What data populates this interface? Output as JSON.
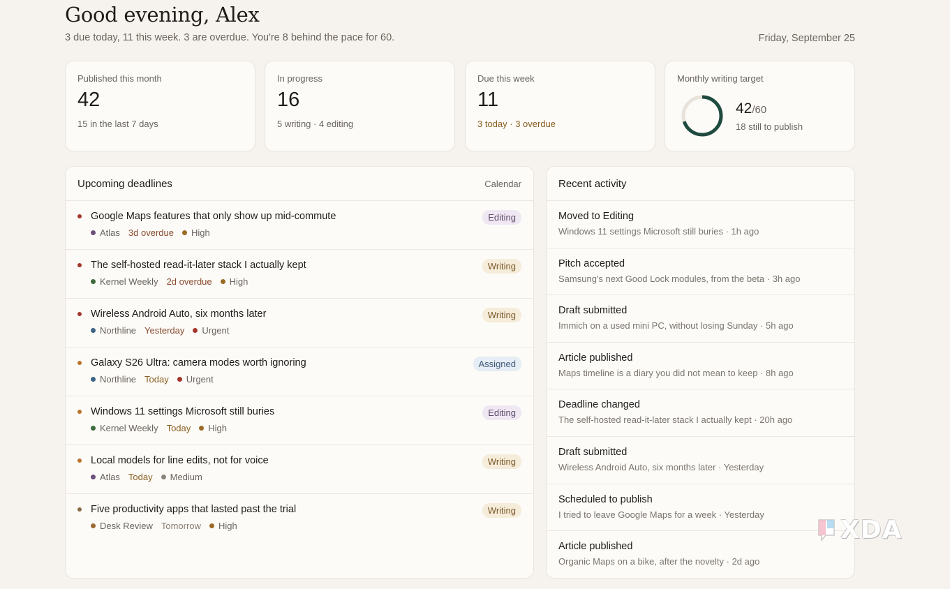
{
  "header": {
    "greeting": "Good evening, Alex",
    "summary": "3 due today, 11 this week. 3 are overdue. You're 8 behind the pace for 60.",
    "date": "Friday, September 25"
  },
  "stats": [
    {
      "label": "Published this month",
      "value": "42",
      "sub": "15 in the last 7 days"
    },
    {
      "label": "In progress",
      "value": "16",
      "sub": "5 writing · 4 editing"
    },
    {
      "label": "Due this week",
      "value": "11",
      "sub": "3 today · 3 overdue"
    }
  ],
  "target": {
    "label": "Monthly writing target",
    "value": "42",
    "of": "/60",
    "sub": "18 still to publish",
    "progress": 0.7,
    "color": "#1f4a3f",
    "track_color": "#e8e2da"
  },
  "deadlines": {
    "title": "Upcoming deadlines",
    "link": "Calendar",
    "items": [
      {
        "title": "Google Maps features that only show up mid-commute",
        "outlet": "Atlas",
        "outlet_color": "#6a4f7a",
        "due": "3d overdue",
        "due_color": "#8a4a2e",
        "priority": "High",
        "priority_color": "#9a6a24",
        "status": "Editing",
        "status_bg": "#efe8f3",
        "status_fg": "#5d4a6a",
        "bullet": "#a2362b"
      },
      {
        "title": "The self-hosted read-it-later stack I actually kept",
        "outlet": "Kernel Weekly",
        "outlet_color": "#3f6a3a",
        "due": "2d overdue",
        "due_color": "#8a4a2e",
        "priority": "High",
        "priority_color": "#9a6a24",
        "status": "Writing",
        "status_bg": "#f6ecda",
        "status_fg": "#7a5a2a",
        "bullet": "#a2362b"
      },
      {
        "title": "Wireless Android Auto, six months later",
        "outlet": "Northline",
        "outlet_color": "#3e6485",
        "due": "Yesterday",
        "due_color": "#8a4a2e",
        "priority": "Urgent",
        "priority_color": "#a2362b",
        "status": "Writing",
        "status_bg": "#f6ecda",
        "status_fg": "#7a5a2a",
        "bullet": "#a2362b"
      },
      {
        "title": "Galaxy S26 Ultra: camera modes worth ignoring",
        "outlet": "Northline",
        "outlet_color": "#3e6485",
        "due": "Today",
        "due_color": "#8a5e1f",
        "priority": "Urgent",
        "priority_color": "#a2362b",
        "status": "Assigned",
        "status_bg": "#e6edf4",
        "status_fg": "#3e5a7a",
        "bullet": "#b8742a"
      },
      {
        "title": "Windows 11 settings Microsoft still buries",
        "outlet": "Kernel Weekly",
        "outlet_color": "#3f6a3a",
        "due": "Today",
        "due_color": "#8a5e1f",
        "priority": "High",
        "priority_color": "#9a6a24",
        "status": "Editing",
        "status_bg": "#efe8f3",
        "status_fg": "#5d4a6a",
        "bullet": "#b8742a"
      },
      {
        "title": "Local models for line edits, not for voice",
        "outlet": "Atlas",
        "outlet_color": "#6a4f7a",
        "due": "Today",
        "due_color": "#8a5e1f",
        "priority": "Medium",
        "priority_color": "#8a837b",
        "status": "Writing",
        "status_bg": "#f6ecda",
        "status_fg": "#7a5a2a",
        "bullet": "#b8742a"
      },
      {
        "title": "Five productivity apps that lasted past the trial",
        "outlet": "Desk Review",
        "outlet_color": "#9a6a34",
        "due": "Tomorrow",
        "due_color": "#8a7a6a",
        "priority": "High",
        "priority_color": "#9a6a24",
        "status": "Writing",
        "status_bg": "#f6ecda",
        "status_fg": "#7a5a2a",
        "bullet": "#8a6a44"
      }
    ]
  },
  "activity": {
    "title": "Recent activity",
    "items": [
      {
        "title": "Moved to Editing",
        "sub": "Windows 11 settings Microsoft still buries · 1h ago"
      },
      {
        "title": "Pitch accepted",
        "sub": "Samsung's next Good Lock modules, from the beta · 3h ago"
      },
      {
        "title": "Draft submitted",
        "sub": "Immich on a used mini PC, without losing Sunday · 5h ago"
      },
      {
        "title": "Article published",
        "sub": "Maps timeline is a diary you did not mean to keep · 8h ago"
      },
      {
        "title": "Deadline changed",
        "sub": "The self-hosted read-it-later stack I actually kept · 20h ago"
      },
      {
        "title": "Draft submitted",
        "sub": "Wireless Android Auto, six months later · Yesterday"
      },
      {
        "title": "Scheduled to publish",
        "sub": "I tried to leave Google Maps for a week · Yesterday"
      },
      {
        "title": "Article published",
        "sub": "Organic Maps on a bike, after the novelty · 2d ago"
      }
    ]
  },
  "watermark": {
    "text": "XDA",
    "icon": "xda-logo-icon"
  }
}
